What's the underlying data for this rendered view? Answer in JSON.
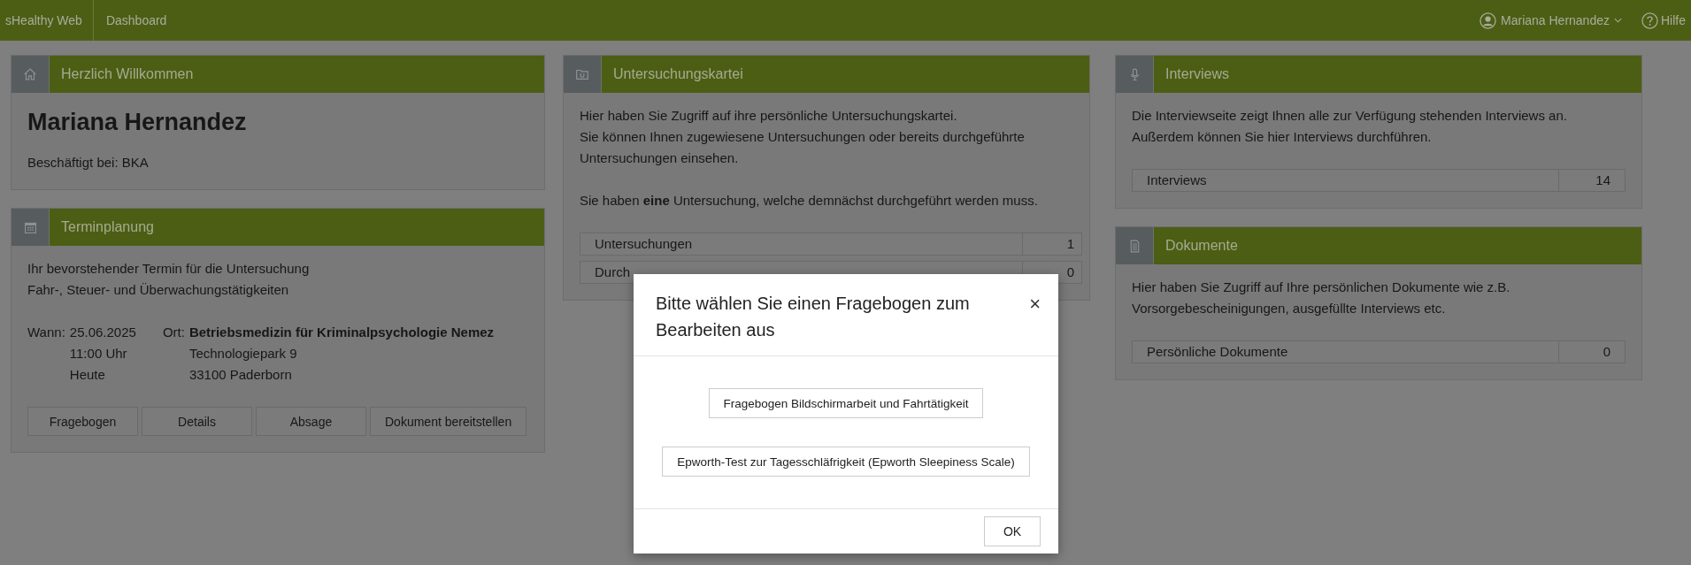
{
  "topbar": {
    "brand": "sHealthy Web",
    "nav": "Dashboard",
    "user": "Mariana Hernandez",
    "help": "Hilfe"
  },
  "columns": [
    [
      {
        "kind": "welcome",
        "title": "Herzlich Willkommen",
        "name": "Mariana Hernandez",
        "employer": "Beschäftigt bei: BKA"
      },
      {
        "kind": "appointment",
        "title": "Terminplanung",
        "intro": [
          "Ihr bevorstehender Termin für die Untersuchung",
          "Fahr-, Steuer- und Überwachungstätigkeiten"
        ],
        "when_label": "Wann:",
        "when": [
          "25.06.2025",
          "11:00 Uhr",
          "Heute"
        ],
        "where_label": "Ort:",
        "where": [
          "Betriebsmedizin für Kriminalpsychologie Nemez",
          "Technologiepark 9",
          "33100 Paderborn"
        ],
        "buttons": [
          "Fragebogen",
          "Details",
          "Absage",
          "Dokument bereitstellen"
        ]
      }
    ],
    [
      {
        "kind": "exam",
        "title": "Untersuchungskartei",
        "paragraphs": [
          [
            "Hier haben Sie Zugriff auf ihre persönliche Untersuchungskartei.",
            "Sie können Ihnen zugewiesene Untersuchungen oder bereits durchgeführte Untersuchungen einsehen."
          ],
          [
            "Sie haben **eine** Untersuchung, welche demnächst durchgeführt werden muss."
          ]
        ],
        "stats": [
          {
            "label": "Untersuchungen",
            "value": "1"
          },
          {
            "label": "Durch",
            "value": "0"
          }
        ]
      }
    ],
    [
      {
        "kind": "interviews",
        "title": "Interviews",
        "paragraphs": [
          [
            "Die Interviewseite zeigt Ihnen alle zur Verfügung stehenden Interviews an.",
            "Außerdem können Sie hier Interviews durchführen."
          ]
        ],
        "stats": [
          {
            "label": "Interviews",
            "value": "14"
          }
        ]
      },
      {
        "kind": "documents",
        "title": "Dokumente",
        "paragraphs": [
          [
            "Hier haben Sie Zugriff auf Ihre persönlichen Dokumente wie z.B.",
            "Vorsorgebescheinigungen, ausgefüllte Interviews etc."
          ]
        ],
        "stats": [
          {
            "label": "Persönliche Dokumente",
            "value": "0"
          }
        ]
      }
    ]
  ],
  "modal": {
    "title": "Bitte wählen Sie einen Fragebogen zum Bearbeiten aus",
    "close": "×",
    "options": [
      "Fragebogen Bildschirmarbeit und Fahrtätigkeit",
      "Epworth-Test zur Tagesschläfrigkeit (Epworth Sleepiness Scale)"
    ],
    "ok": "OK"
  }
}
